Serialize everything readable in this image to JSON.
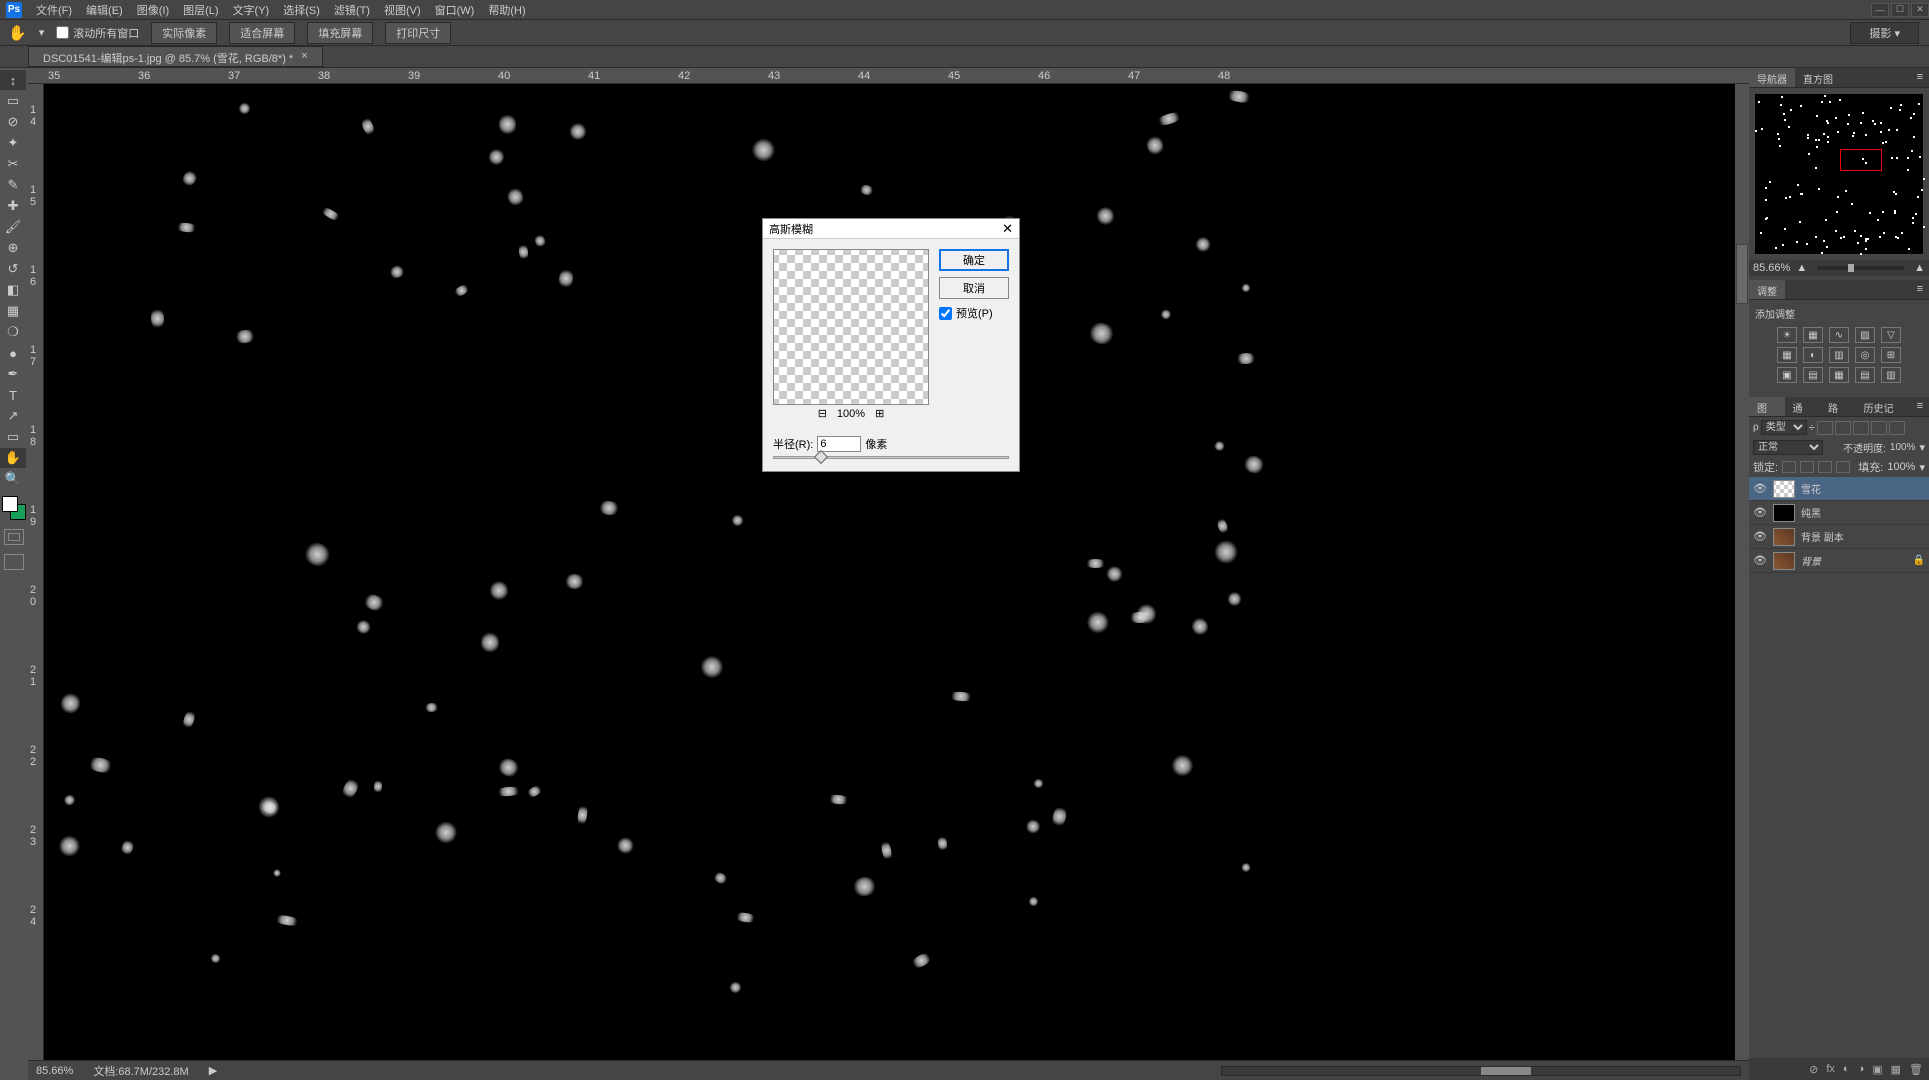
{
  "menubar": {
    "items": [
      "文件(F)",
      "编辑(E)",
      "图像(I)",
      "图层(L)",
      "文字(Y)",
      "选择(S)",
      "滤镜(T)",
      "视图(V)",
      "窗口(W)",
      "帮助(H)"
    ]
  },
  "optbar": {
    "scroll_all": "滚动所有窗口",
    "actual_pixels": "实际像素",
    "fit_screen": "适合屏幕",
    "fill_screen": "填充屏幕",
    "print_size": "打印尺寸",
    "workspace": "摄影"
  },
  "doctab": {
    "label": "DSC01541-编辑ps-1.jpg @ 85.7% (雪花, RGB/8*) *",
    "close": "×"
  },
  "ruler_h": [
    "35",
    "36",
    "37",
    "38",
    "39",
    "40",
    "41",
    "42",
    "43",
    "44",
    "45",
    "46",
    "47",
    "48"
  ],
  "ruler_v": [
    "1 4",
    "1 5",
    "1 6",
    "1 7",
    "1 8",
    "1 9",
    "2 0",
    "2 1",
    "2 2",
    "2 3",
    "2 4"
  ],
  "status": {
    "zoom": "85.66%",
    "doc": "文档:68.7M/232.8M"
  },
  "panels": {
    "navigator": {
      "tabs": [
        "导航器",
        "直方图"
      ],
      "zoom": "85.66%"
    },
    "adjustments": {
      "tab": "调整",
      "title": "添加调整"
    },
    "layers": {
      "tabs": [
        "图层",
        "通道",
        "路径",
        "历史记录"
      ],
      "type_label": "类型",
      "blend": "正常",
      "opacity_label": "不透明度:",
      "opacity": "100%",
      "lock_label": "锁定:",
      "fill_label": "填充:",
      "fill": "100%",
      "items": [
        {
          "name": "雪花",
          "kind": "checker"
        },
        {
          "name": "纯黑",
          "kind": "black"
        },
        {
          "name": "背景 副本",
          "kind": "img"
        },
        {
          "name": "背景",
          "kind": "img",
          "locked": true
        }
      ]
    }
  },
  "dialog": {
    "title": "高斯模糊",
    "ok": "确定",
    "cancel": "取消",
    "preview": "预览(P)",
    "preview_zoom": "100%",
    "radius_label": "半径(R):",
    "radius_value": "6",
    "radius_unit": "像素"
  }
}
